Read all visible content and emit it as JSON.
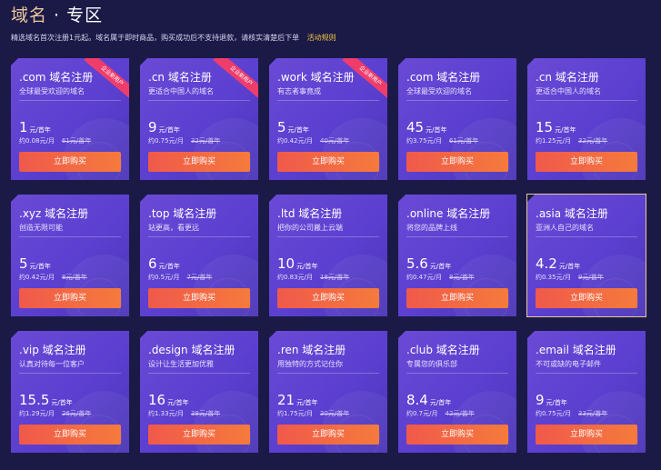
{
  "header": {
    "title_main": "域名",
    "title_sep": " · ",
    "title_zone": "专区",
    "notice": "精选域名首次注册1元起。域名属于即时商品，购买成功后不支持退款，请核实清楚后下单",
    "rules_link": "活动规则"
  },
  "cards": [
    {
      "name": ".com 域名注册",
      "desc": "全球最受欢迎的域名",
      "price": "1",
      "unit": "元/首年",
      "monthly": "约0.08元/月",
      "original": "61元/首年",
      "button": "立即购买",
      "ribbon": "企业新用户"
    },
    {
      "name": ".cn 域名注册",
      "desc": "更适合中国人的域名",
      "price": "9",
      "unit": "元/首年",
      "monthly": "约0.75元/月",
      "original": "32元/首年",
      "button": "立即购买",
      "ribbon": "企业新用户"
    },
    {
      "name": ".work 域名注册",
      "desc": "有志者事竟成",
      "price": "5",
      "unit": "元/首年",
      "monthly": "约0.42元/月",
      "original": "40元/首年",
      "button": "立即购买",
      "ribbon": "企业新用户"
    },
    {
      "name": ".com 域名注册",
      "desc": "全球最受欢迎的域名",
      "price": "45",
      "unit": "元/首年",
      "monthly": "约3.75元/月",
      "original": "61元/首年",
      "button": "立即购买"
    },
    {
      "name": ".cn 域名注册",
      "desc": "更适合中国人的域名",
      "price": "15",
      "unit": "元/首年",
      "monthly": "约1.25元/月",
      "original": "32元/首年",
      "button": "立即购买"
    },
    {
      "name": ".xyz 域名注册",
      "desc": "创造无限可能",
      "price": "5",
      "unit": "元/首年",
      "monthly": "约0.42元/月",
      "original": "8元/首年",
      "button": "立即购买"
    },
    {
      "name": ".top 域名注册",
      "desc": "站更高，看更远",
      "price": "6",
      "unit": "元/首年",
      "monthly": "约0.5元/月",
      "original": "7元/首年",
      "button": "立即购买"
    },
    {
      "name": ".ltd 域名注册",
      "desc": "把你的公司搬上云端",
      "price": "10",
      "unit": "元/首年",
      "monthly": "约0.83元/月",
      "original": "18元/首年",
      "button": "立即购买"
    },
    {
      "name": ".online 域名注册",
      "desc": "将您的品牌上线",
      "price": "5.6",
      "unit": "元/首年",
      "monthly": "约0.47元/月",
      "original": "8元/首年",
      "button": "立即购买"
    },
    {
      "name": ".asia 域名注册",
      "desc": "亚洲人自己的域名",
      "price": "4.2",
      "unit": "元/首年",
      "monthly": "约0.35元/月",
      "original": "9元/首年",
      "button": "立即购买",
      "highlight": true
    },
    {
      "name": ".vip 域名注册",
      "desc": "认真对待每一位客户",
      "price": "15.5",
      "unit": "元/首年",
      "monthly": "约1.29元/月",
      "original": "26元/首年",
      "button": "立即购买"
    },
    {
      "name": ".design 域名注册",
      "desc": "设计让生活更加优雅",
      "price": "16",
      "unit": "元/首年",
      "monthly": "约1.33元/月",
      "original": "38元/首年",
      "button": "立即购买"
    },
    {
      "name": ".ren 域名注册",
      "desc": "用独特的方式记住你",
      "price": "21",
      "unit": "元/首年",
      "monthly": "约1.75元/月",
      "original": "30元/首年",
      "button": "立即购买"
    },
    {
      "name": ".club 域名注册",
      "desc": "专属您的俱乐部",
      "price": "8.4",
      "unit": "元/首年",
      "monthly": "约0.7元/月",
      "original": "42元/首年",
      "button": "立即购买"
    },
    {
      "name": ".email 域名注册",
      "desc": "不可或缺的电子邮件",
      "price": "9",
      "unit": "元/首年",
      "monthly": "约0.75元/月",
      "original": "33元/首年",
      "button": "立即购买"
    }
  ]
}
